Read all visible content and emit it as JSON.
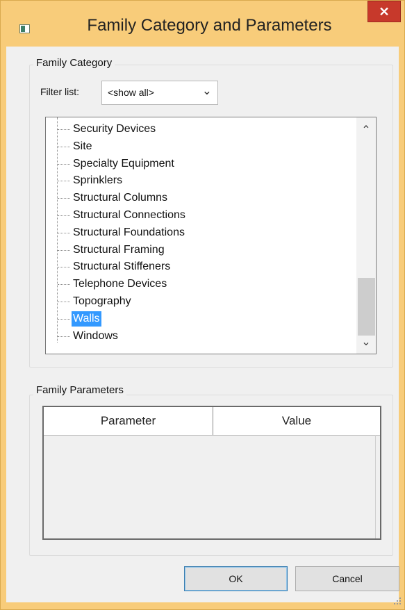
{
  "window": {
    "title": "Family Category and Parameters",
    "close_label": "✕"
  },
  "family_category": {
    "group_label": "Family Category",
    "filter_label": "Filter list:",
    "filter_value": "<show all>",
    "items": [
      {
        "label": "Security Devices",
        "selected": false
      },
      {
        "label": "Site",
        "selected": false
      },
      {
        "label": "Specialty Equipment",
        "selected": false
      },
      {
        "label": "Sprinklers",
        "selected": false
      },
      {
        "label": "Structural Columns",
        "selected": false
      },
      {
        "label": "Structural Connections",
        "selected": false
      },
      {
        "label": "Structural Foundations",
        "selected": false
      },
      {
        "label": "Structural Framing",
        "selected": false
      },
      {
        "label": "Structural Stiffeners",
        "selected": false
      },
      {
        "label": "Telephone Devices",
        "selected": false
      },
      {
        "label": "Topography",
        "selected": false
      },
      {
        "label": "Walls",
        "selected": true
      },
      {
        "label": "Windows",
        "selected": false
      }
    ]
  },
  "family_parameters": {
    "group_label": "Family Parameters",
    "columns": [
      "Parameter",
      "Value"
    ],
    "rows": []
  },
  "buttons": {
    "ok": "OK",
    "cancel": "Cancel"
  },
  "colors": {
    "titlebar": "#f8cc7a",
    "close": "#c7392b",
    "selection": "#3399ff"
  }
}
